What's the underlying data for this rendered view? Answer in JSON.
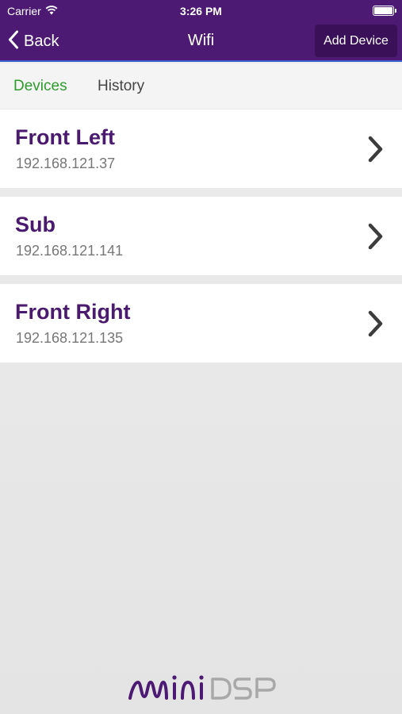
{
  "status_bar": {
    "carrier": "Carrier",
    "time": "3:26 PM",
    "battery_level": 1.0
  },
  "nav": {
    "back_label": "Back",
    "title": "Wifi",
    "add_device_label": "Add Device"
  },
  "tabs": [
    {
      "label": "Devices",
      "active": true
    },
    {
      "label": "History",
      "active": false
    }
  ],
  "devices": [
    {
      "name": "Front Left",
      "ip": "192.168.121.37"
    },
    {
      "name": "Sub",
      "ip": "192.168.121.141"
    },
    {
      "name": "Front Right",
      "ip": "192.168.121.135"
    }
  ],
  "brand": {
    "logo_text": "miniDSP",
    "primary_color": "#4c1a72",
    "active_tab_color": "#2e9b2e"
  }
}
